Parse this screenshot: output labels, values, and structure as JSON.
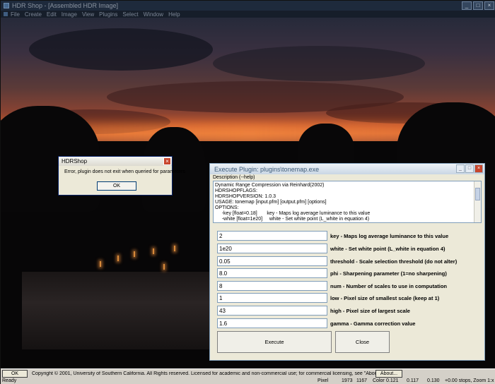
{
  "app": {
    "title": "HDR Shop - [Assembled HDR Image]",
    "menu": [
      "File",
      "Create",
      "Edit",
      "Image",
      "View",
      "Plugins",
      "Select",
      "Window",
      "Help"
    ]
  },
  "bottom": {
    "ok_label": "OK",
    "copyright": "Copyright © 2001, University of Southern California. All Rights reserved.   Licensed for academic and non-commercial use; for commercial licensing, see \"About\".",
    "about_label": "About..."
  },
  "status": {
    "ready": "Ready",
    "pixel_label": "Pixel",
    "pixel_x": "1973",
    "pixel_y": "1167",
    "color_label": "Color",
    "color_r": "0.121",
    "color_g": "0.117",
    "color_b": "0.130",
    "zoom": "+0.00 stops, Zoom 1:x"
  },
  "error_dialog": {
    "title": "HDRShop",
    "message": "Error, plugin does not exit when queried for parameters",
    "ok_label": "OK"
  },
  "plugin_dialog": {
    "title": "Execute Plugin: plugins\\tonemap.exe",
    "description_label": "Description (--help)",
    "description_lines": [
      "Dynamic Range Compression via Reinhard(2002)",
      "HDRSHOPFLAGS:",
      "HDRSHOPVERSION: 1.0.3",
      "USAGE: tonemap [input.pfm] [output.pfm] [options]",
      "OPTIONS:",
      "     -key [float=0.18]       key - Maps log average luminance to this value",
      "     -white [float=1e20]     white - Set white point (L_white in equation 4)"
    ],
    "params": [
      {
        "value": "2",
        "label": "key - Maps log average luminance to this value"
      },
      {
        "value": "1e20",
        "label": "white - Set white point (L_white in equation 4)"
      },
      {
        "value": "0.05",
        "label": "threshold - Scale selection threshold (do not alter)"
      },
      {
        "value": "8.0",
        "label": "phi - Sharpening parameter (1=no sharpening)"
      },
      {
        "value": "8",
        "label": "num - Number of scales to use in computation"
      },
      {
        "value": "1",
        "label": "low - Pixel size of smallest scale (keep at 1)"
      },
      {
        "value": "43",
        "label": "high - Pixel size of largest scale"
      },
      {
        "value": "1.6",
        "label": "gamma - Gamma correction value"
      }
    ],
    "execute_label": "Execute",
    "close_label": "Close"
  }
}
